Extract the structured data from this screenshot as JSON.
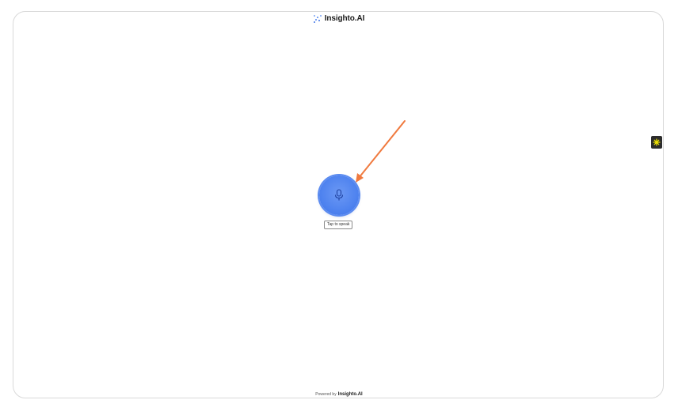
{
  "brand": {
    "name": "Insighto.AI",
    "logo_icon": "dots-grid-logo-icon"
  },
  "mic": {
    "icon": "microphone-icon",
    "tooltip": "Tap to speak",
    "accent_color": "#4f83ef"
  },
  "annotation": {
    "icon": "arrow-icon",
    "color": "#f07a3f"
  },
  "side_widget": {
    "icon": "sparkle-icon",
    "bg_color": "#2c2c2c",
    "icon_color": "#f2e600"
  },
  "footer": {
    "prefix": "Powered by",
    "brand": "Insighto.AI"
  }
}
